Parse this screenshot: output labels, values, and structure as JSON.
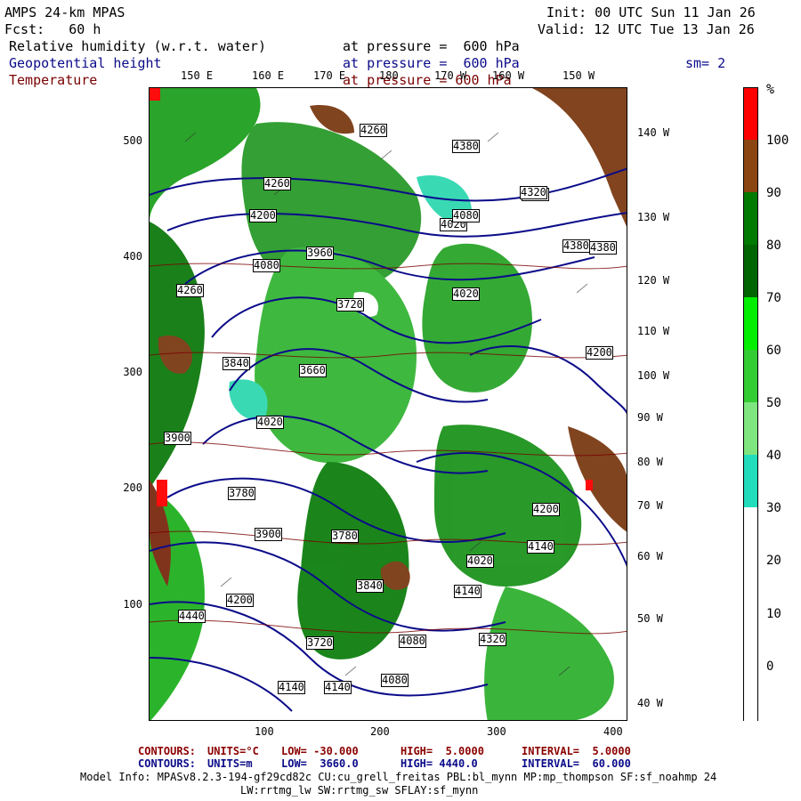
{
  "header": {
    "model": "AMPS 24-km MPAS",
    "fcst": "Fcst:   60 h",
    "init": "Init: 00 UTC Sun 11 Jan 26",
    "valid": "Valid: 12 UTC Tue 13 Jan 26",
    "field1": "Relative humidity (w.r.t. water)",
    "field1_level": "at pressure =  600 hPa",
    "field2": "Geopotential height",
    "field2_level": "at pressure =  600 hPa",
    "sm": "sm= 2",
    "field3": "Temperature",
    "field3_level": "at pressure = 600 hPa"
  },
  "map": {
    "top_lon_labels": [
      "150 E",
      "160 E",
      "170 E",
      "180",
      "170 W",
      "160 W",
      "150 W"
    ],
    "right_lon_labels": [
      "140 W",
      "130 W",
      "120 W",
      "110 W",
      "100 W",
      "90 W",
      "80 W",
      "70 W",
      "60 W",
      "50 W",
      "40 W"
    ],
    "left_ticks": [
      "500",
      "400",
      "300",
      "200",
      "100"
    ],
    "bottom_ticks": [
      "100",
      "200",
      "300",
      "400"
    ],
    "height_labels": [
      "4260",
      "4380",
      "4380",
      "4260",
      "4200",
      "4260",
      "4080",
      "3960",
      "4020",
      "4080",
      "3720",
      "3660",
      "3840",
      "3780",
      "3900",
      "4200",
      "4140",
      "4020",
      "4140",
      "4380",
      "4320",
      "4080",
      "4440",
      "4320",
      "3900",
      "3840",
      "3720",
      "4080",
      "4200",
      "4140",
      "4020",
      "4200",
      "4140",
      "4020",
      "3780",
      "4380"
    ]
  },
  "colorbar": {
    "unit": "%",
    "labels": [
      "100",
      "90",
      "80",
      "70",
      "60",
      "50",
      "40",
      "30",
      "20",
      "10",
      "0"
    ],
    "colors": [
      "#ff0000",
      "#8b4513",
      "#007a00",
      "#006400",
      "#00ee00",
      "#33cc33",
      "#7fe57f",
      "#22ddbb",
      "#ffffff",
      "#ffffff",
      "#ffffff",
      "#ffffff"
    ]
  },
  "footer": {
    "temp_line": {
      "contours": "CONTOURS:",
      "units": "UNITS=°C",
      "low": "LOW= -30.000",
      "high": "HIGH=  5.0000",
      "interval": "INTERVAL=  5.0000"
    },
    "height_line": {
      "contours": "CONTOURS:",
      "units": "UNITS=m",
      "low": "LOW=  3660.0",
      "high": "HIGH= 4440.0",
      "interval": "INTERVAL=  60.000"
    },
    "model_info": "Model Info: MPASv8.2.3-194-gf29cd82c CU:cu_grell_freitas PBL:bl_mynn MP:mp_thompson SF:sf_noahmp 24",
    "model_info2": "LW:rrtmg_lw SW:rrtmg_sw SFLAY:sf_mynn"
  }
}
